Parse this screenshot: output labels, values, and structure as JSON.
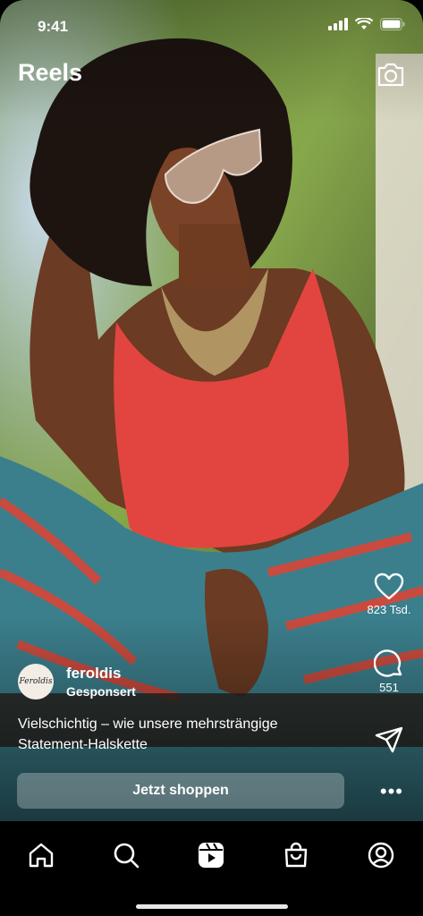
{
  "status_bar": {
    "time": "9:41"
  },
  "header": {
    "title": "Reels",
    "camera_icon": "camera-icon"
  },
  "rail": {
    "likes": "823 Tsd.",
    "comments": "551",
    "icons": [
      "heart-icon",
      "comment-icon",
      "share-icon"
    ]
  },
  "post": {
    "avatar_text": "Feroldis",
    "username": "feroldis",
    "sponsored": "Gesponsert",
    "caption": "Vielschichtig – wie unsere mehrsträngige Statement-Halskette",
    "cta": "Jetzt shoppen",
    "more": "•••"
  },
  "tabbar": {
    "items": [
      "home-icon",
      "search-icon",
      "reels-icon",
      "shop-icon",
      "profile-icon"
    ],
    "active": "reels-icon"
  },
  "colors": {
    "text": "#ffffff",
    "tabbar_bg": "#000000",
    "top_red": "#e2453f",
    "pants_teal": "#3b7f8c"
  }
}
